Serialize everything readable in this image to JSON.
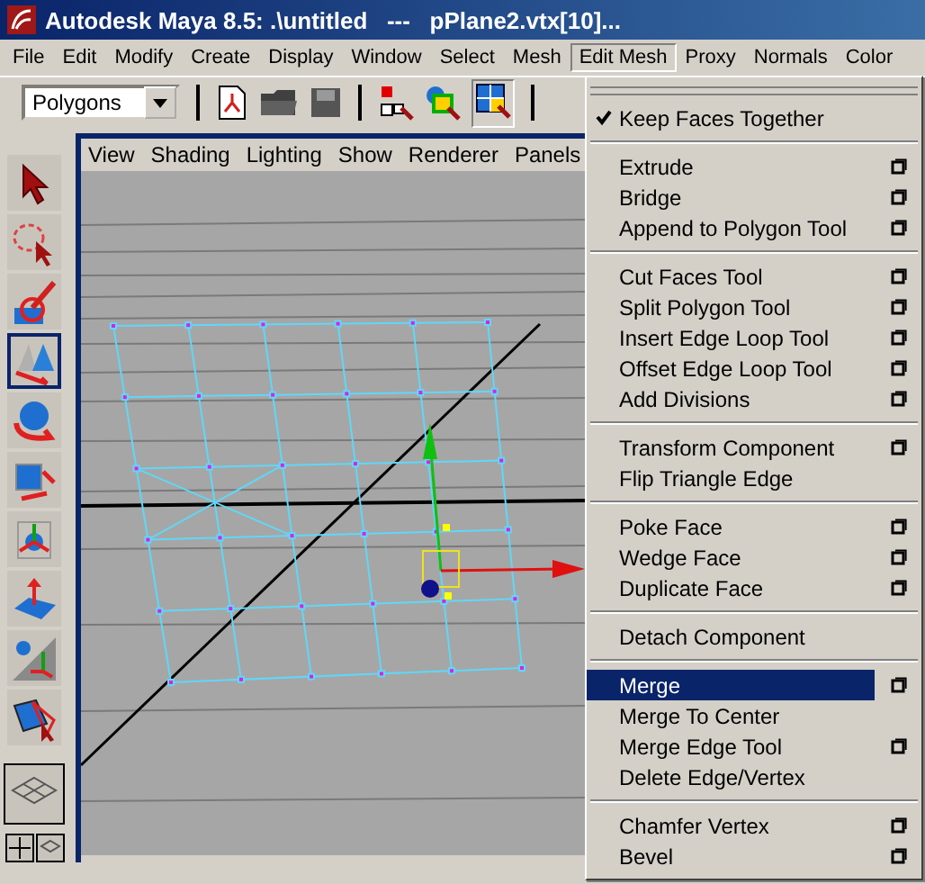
{
  "window": {
    "title": "Autodesk Maya 8.5: .\\untitled   ---   pPlane2.vtx[10]..."
  },
  "menubar": [
    {
      "label": "File",
      "selected": false
    },
    {
      "label": "Edit",
      "selected": false
    },
    {
      "label": "Modify",
      "selected": false
    },
    {
      "label": "Create",
      "selected": false
    },
    {
      "label": "Display",
      "selected": false
    },
    {
      "label": "Window",
      "selected": false
    },
    {
      "label": "Select",
      "selected": false
    },
    {
      "label": "Mesh",
      "selected": false
    },
    {
      "label": "Edit Mesh",
      "selected": true
    },
    {
      "label": "Proxy",
      "selected": false
    },
    {
      "label": "Normals",
      "selected": false
    },
    {
      "label": "Color",
      "selected": false
    }
  ],
  "toolbar": {
    "menu_set": "Polygons"
  },
  "toolbox": [
    {
      "selected": false
    },
    {
      "selected": false
    },
    {
      "selected": false
    },
    {
      "selected": true
    },
    {
      "selected": false
    },
    {
      "selected": false
    },
    {
      "selected": false
    },
    {
      "selected": false
    },
    {
      "selected": false
    },
    {
      "selected": false
    }
  ],
  "viewport": {
    "menu": [
      "View",
      "Shading",
      "Lighting",
      "Show",
      "Renderer",
      "Panels"
    ]
  },
  "edit_mesh_menu": {
    "sections": [
      [
        {
          "label": "Keep Faces Together",
          "checked": true,
          "option_box": false,
          "selected": false
        }
      ],
      [
        {
          "label": "Extrude",
          "option_box": true,
          "selected": false
        },
        {
          "label": "Bridge",
          "option_box": true,
          "selected": false
        },
        {
          "label": "Append to Polygon Tool",
          "option_box": true,
          "selected": false
        }
      ],
      [
        {
          "label": "Cut Faces Tool",
          "option_box": true,
          "selected": false
        },
        {
          "label": "Split Polygon Tool",
          "option_box": true,
          "selected": false
        },
        {
          "label": "Insert Edge Loop Tool",
          "option_box": true,
          "selected": false
        },
        {
          "label": "Offset Edge Loop Tool",
          "option_box": true,
          "selected": false
        },
        {
          "label": "Add Divisions",
          "option_box": true,
          "selected": false
        }
      ],
      [
        {
          "label": "Transform Component",
          "option_box": true,
          "selected": false
        },
        {
          "label": "Flip Triangle Edge",
          "option_box": false,
          "selected": false
        }
      ],
      [
        {
          "label": "Poke Face",
          "option_box": true,
          "selected": false
        },
        {
          "label": "Wedge Face",
          "option_box": true,
          "selected": false
        },
        {
          "label": "Duplicate Face",
          "option_box": true,
          "selected": false
        }
      ],
      [
        {
          "label": "Detach Component",
          "option_box": false,
          "selected": false
        }
      ],
      [
        {
          "label": "Merge",
          "option_box": true,
          "selected": true
        },
        {
          "label": "Merge To Center",
          "option_box": false,
          "selected": false
        },
        {
          "label": "Merge Edge Tool",
          "option_box": true,
          "selected": false
        },
        {
          "label": "Delete Edge/Vertex",
          "option_box": false,
          "selected": false
        }
      ],
      [
        {
          "label": "Chamfer Vertex",
          "option_box": true,
          "selected": false
        },
        {
          "label": "Bevel",
          "option_box": true,
          "selected": false
        }
      ]
    ]
  }
}
